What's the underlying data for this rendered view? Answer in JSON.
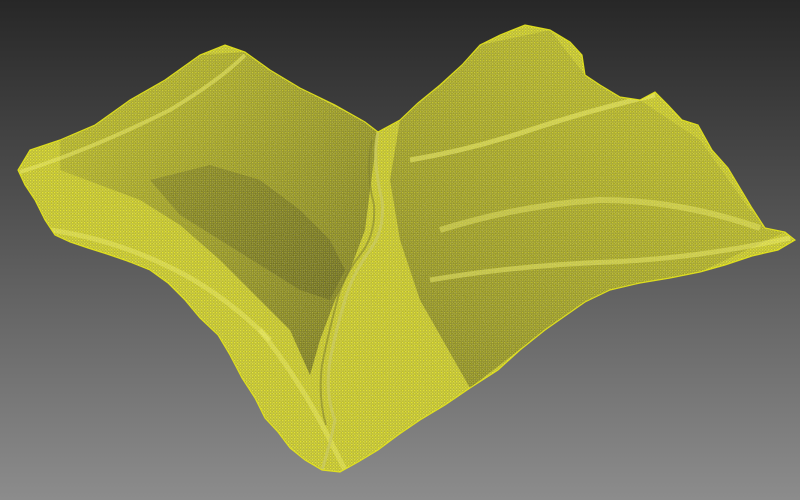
{
  "scene": {
    "background_top": "#272727",
    "background_bottom": "#8c8c8c",
    "point_color": "#e6e619",
    "point_color_light": "#f2f24a",
    "point_color_shadow": "#6b6b12",
    "point_color_mid": "#b8b819",
    "river_color": "#c9c94a"
  }
}
